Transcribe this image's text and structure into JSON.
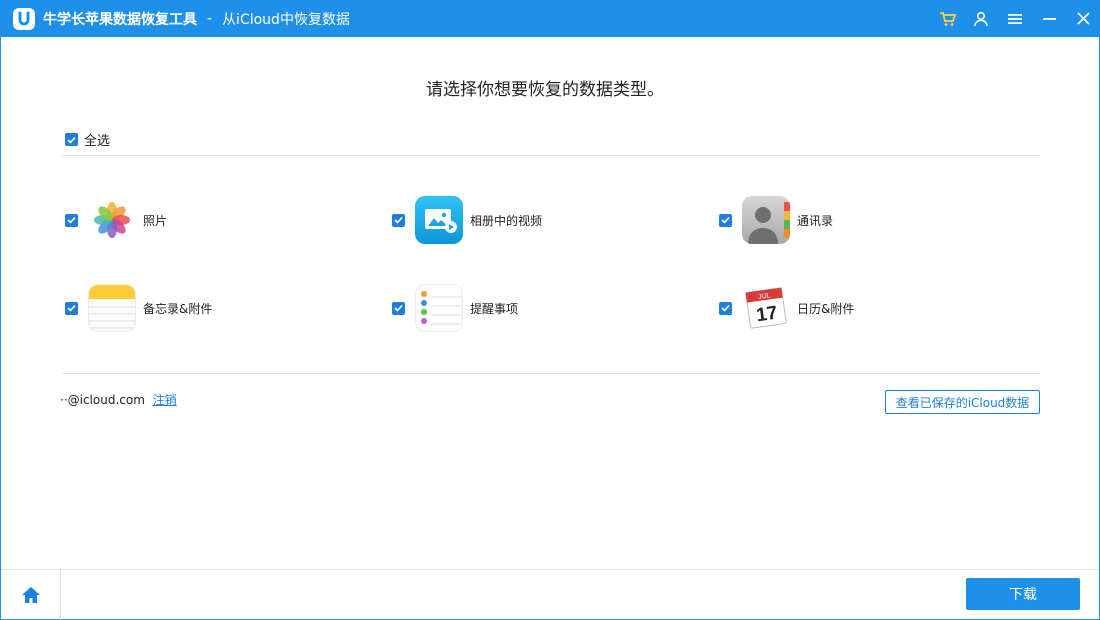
{
  "titlebar": {
    "app_name": "牛学长苹果数据恢复工具",
    "separator": "-",
    "subtitle": "从iCloud中恢复数据",
    "controls": [
      "cart-icon",
      "user-icon",
      "menu-icon",
      "minimize-icon",
      "close-icon"
    ]
  },
  "main": {
    "heading": "请选择你想要恢复的数据类型。",
    "select_all": {
      "label": "全选",
      "checked": true
    },
    "items": [
      {
        "label": "照片",
        "icon": "photos-icon",
        "checked": true
      },
      {
        "label": "相册中的视频",
        "icon": "album-video-icon",
        "checked": true
      },
      {
        "label": "通讯录",
        "icon": "contacts-icon",
        "checked": true
      },
      {
        "label": "备忘录&附件",
        "icon": "notes-icon",
        "checked": true
      },
      {
        "label": "提醒事项",
        "icon": "reminders-icon",
        "checked": true
      },
      {
        "label": "日历&附件",
        "icon": "calendar-icon",
        "checked": true
      }
    ],
    "calendar_month": "JUL",
    "calendar_day": "17"
  },
  "account": {
    "email": "··@icloud.com",
    "logout_label": "注销"
  },
  "saved_button_label": "查看已保存的iCloud数据",
  "footer": {
    "home_icon": "home-icon",
    "download_label": "下载"
  },
  "colors": {
    "accent": "#1e90ea",
    "checkbox": "#1e7fe0"
  }
}
